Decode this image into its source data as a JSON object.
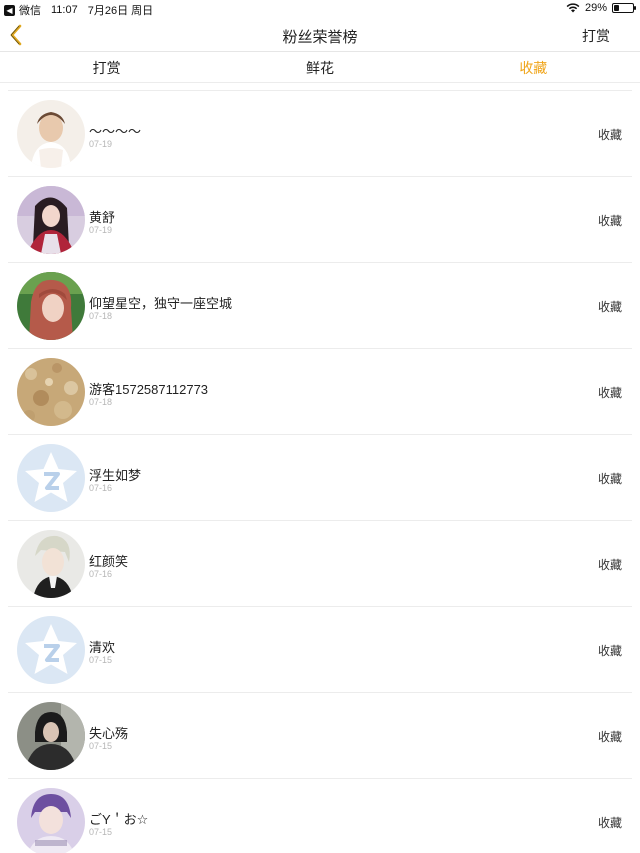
{
  "status_bar": {
    "back_app": "微信",
    "time": "11:07",
    "date": "7月26日 周日",
    "battery": "29%",
    "battery_level": 0.29
  },
  "nav": {
    "back_icon": "chevron-left-icon",
    "title": "粉丝荣誉榜",
    "right_label": "打赏"
  },
  "tabs": [
    {
      "label": "打赏",
      "active": false
    },
    {
      "label": "鲜花",
      "active": false
    },
    {
      "label": "收藏",
      "active": true
    }
  ],
  "colors": {
    "accent": "#f0a51a",
    "date_text": "#b6b6b6",
    "divider": "#ececec"
  },
  "rows": [
    {
      "name": "～～～～",
      "date": "07-19",
      "action": "收藏",
      "avatar": "photo-girl-white-dress"
    },
    {
      "name": "黄舒",
      "date": "07-19",
      "action": "收藏",
      "avatar": "photo-anime-girl"
    },
    {
      "name": "仰望星空，独守一座空城",
      "date": "07-18",
      "action": "收藏",
      "avatar": "photo-girl-red-hair"
    },
    {
      "name": "游客1572587112773",
      "date": "07-18",
      "action": "收藏",
      "avatar": "photo-gold-texture"
    },
    {
      "name": "浮生如梦",
      "date": "07-16",
      "action": "收藏",
      "avatar": "default-qq-avatar-icon"
    },
    {
      "name": "红颜笑",
      "date": "07-16",
      "action": "收藏",
      "avatar": "photo-boy-silver-hair"
    },
    {
      "name": "清欢",
      "date": "07-15",
      "action": "收藏",
      "avatar": "default-qq-avatar-icon"
    },
    {
      "name": "失心殇",
      "date": "07-15",
      "action": "收藏",
      "avatar": "photo-dark-figure"
    },
    {
      "name": "ごY＇お☆",
      "date": "07-15",
      "action": "收藏",
      "avatar": "photo-boy-purple"
    }
  ]
}
